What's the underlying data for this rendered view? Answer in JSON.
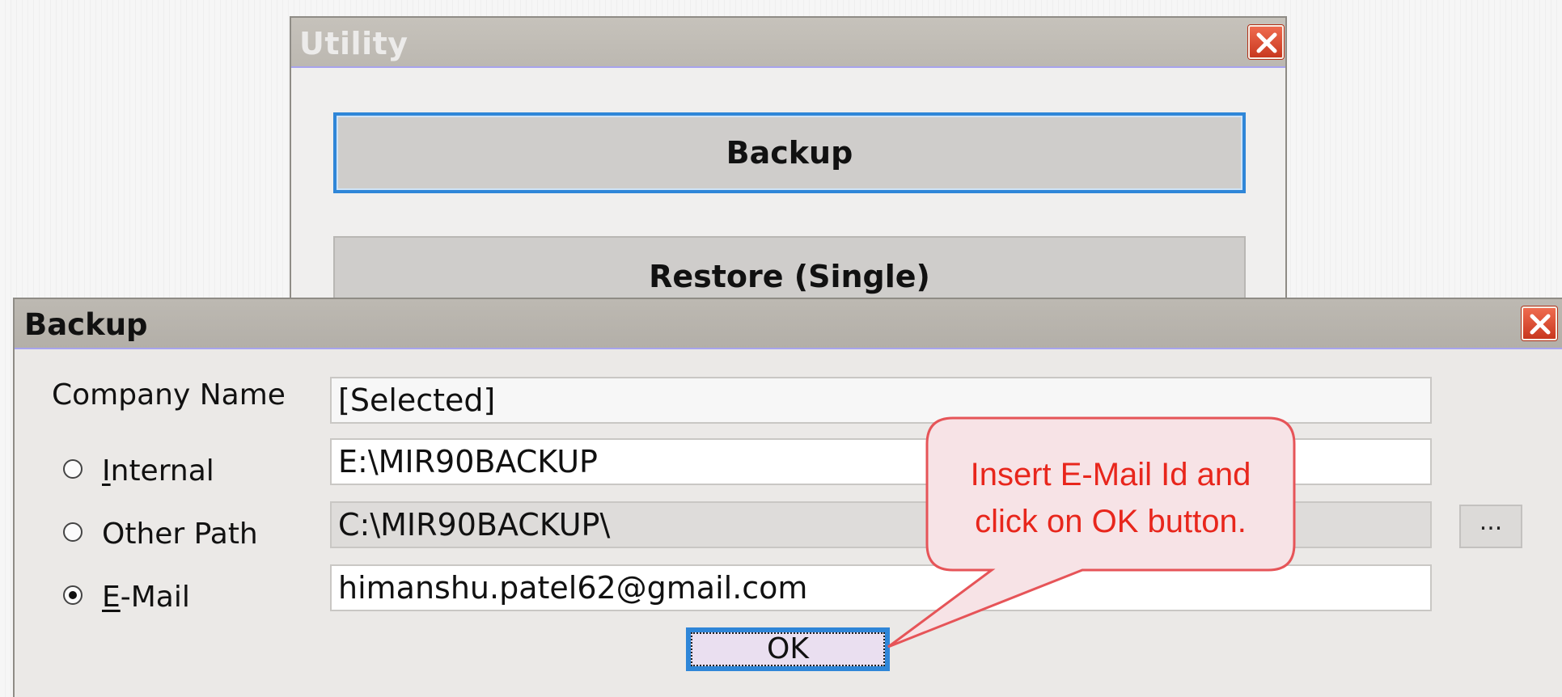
{
  "utility_window": {
    "title": "Utility",
    "buttons": {
      "backup": "Backup",
      "restore_single": "Restore (Single)"
    }
  },
  "backup_dialog": {
    "title": "Backup",
    "company_label": "Company Name",
    "company_value": "[Selected]",
    "options": {
      "internal": {
        "prefix": "I",
        "rest": "nternal",
        "path": "E:\\MIR90BACKUP",
        "selected": false
      },
      "other_path": {
        "label": "Other Path",
        "path": "C:\\MIR90BACKUP\\",
        "selected": false
      },
      "email": {
        "prefix": "E",
        "rest": "-Mail",
        "value": "himanshu.patel62@gmail.com",
        "selected": true
      }
    },
    "browse_label": "...",
    "ok_label": "OK"
  },
  "callout": {
    "line1": "Insert E-Mail Id and",
    "line2": "click on OK button."
  },
  "colors": {
    "accent_focus": "#2f86d8",
    "close_red": "#d9442a",
    "callout_text": "#e8261c",
    "callout_fill": "#f7e3e6"
  }
}
